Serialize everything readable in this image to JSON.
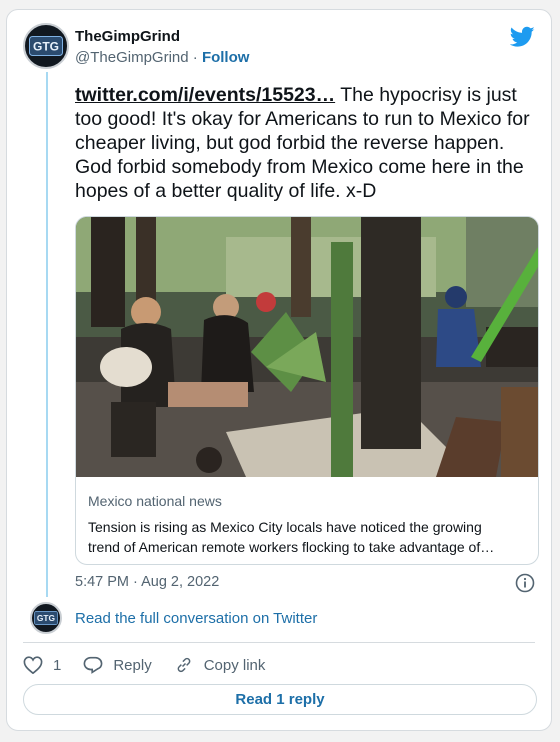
{
  "author": {
    "name": "TheGimpGrind",
    "handle": "@TheGimpGrind",
    "separator": "·",
    "follow_label": "Follow",
    "avatar_text": "GTG"
  },
  "tweet": {
    "link_text": "twitter.com/i/events/15523…",
    "body": " The hypocrisy is just too good! It's okay for Americans to run to Mexico for cheaper living, but god forbid the reverse happen. God forbid somebody from Mexico come here in the hopes of a better quality of life. x-D"
  },
  "media_card": {
    "source": "Mexico national news",
    "description_line1": "Tension is rising as Mexico City locals have noticed the growing",
    "description_line2": "trend of American remote workers flocking to take advantage of…"
  },
  "timestamp": "5:47 PM · Aug 2, 2022",
  "read_conversation_label": "Read the full conversation on Twitter",
  "actions": {
    "like_count": "1",
    "reply_label": "Reply",
    "copy_link_label": "Copy link"
  },
  "read_replies_label": "Read 1 reply",
  "colors": {
    "twitter_blue": "#1d9bf0",
    "link_blue": "#1d6fa8",
    "thread_line": "#a7d9f2"
  },
  "icons": [
    "twitter-bird-icon",
    "info-icon",
    "heart-icon",
    "reply-icon",
    "link-icon"
  ]
}
